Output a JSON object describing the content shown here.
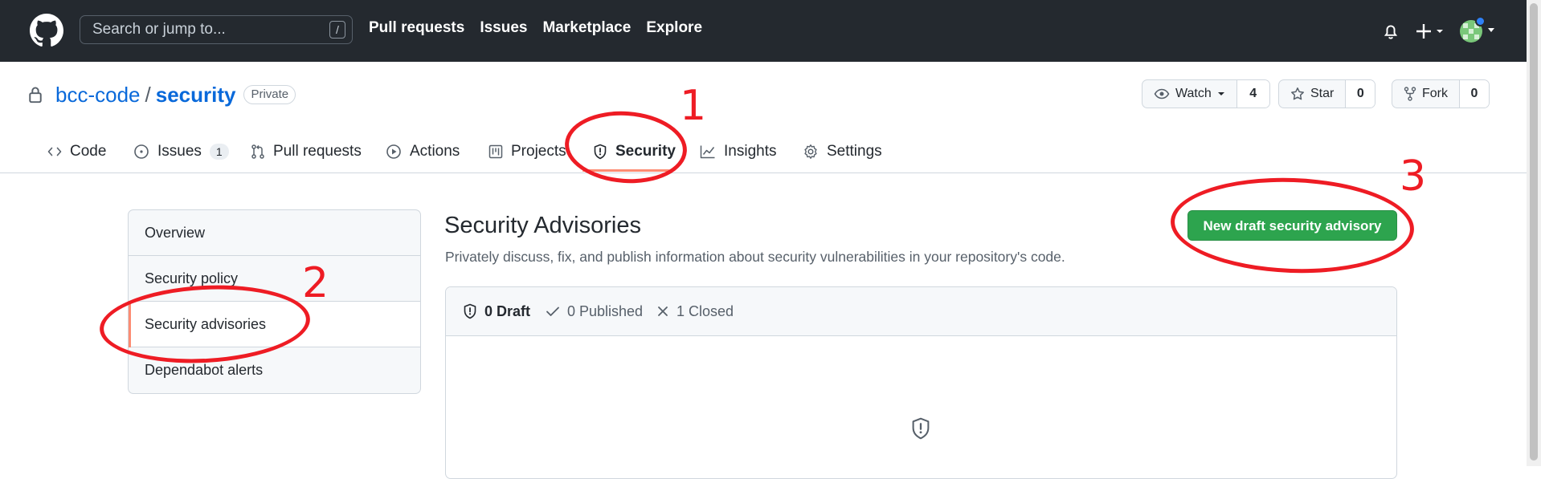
{
  "header": {
    "search_placeholder": "Search or jump to...",
    "search_shortcut": "/",
    "nav": [
      "Pull requests",
      "Issues",
      "Marketplace",
      "Explore"
    ]
  },
  "repo": {
    "owner": "bcc-code",
    "separator": "/",
    "name": "security",
    "visibility": "Private",
    "watch_label": "Watch",
    "watch_count": "4",
    "star_label": "Star",
    "star_count": "0",
    "fork_label": "Fork",
    "fork_count": "0"
  },
  "tabs": [
    {
      "label": "Code",
      "icon": "code-icon"
    },
    {
      "label": "Issues",
      "icon": "issue-opened-icon",
      "count": "1"
    },
    {
      "label": "Pull requests",
      "icon": "git-pull-request-icon"
    },
    {
      "label": "Actions",
      "icon": "play-icon"
    },
    {
      "label": "Projects",
      "icon": "project-icon"
    },
    {
      "label": "Security",
      "icon": "shield-icon",
      "selected": true
    },
    {
      "label": "Insights",
      "icon": "graph-icon"
    },
    {
      "label": "Settings",
      "icon": "gear-icon"
    }
  ],
  "sidebar": {
    "items": [
      {
        "label": "Overview"
      },
      {
        "label": "Security policy"
      },
      {
        "label": "Security advisories",
        "selected": true
      },
      {
        "label": "Dependabot alerts"
      }
    ]
  },
  "main": {
    "title": "Security Advisories",
    "description": "Privately discuss, fix, and publish information about security vulnerabilities in your repository's code.",
    "new_button": "New draft security advisory",
    "filters": [
      {
        "label": "0 Draft",
        "icon": "shield-icon",
        "active": true
      },
      {
        "label": "0 Published",
        "icon": "check-icon"
      },
      {
        "label": "1 Closed",
        "icon": "x-icon"
      }
    ]
  },
  "annotations": {
    "labels": [
      "1",
      "2",
      "3"
    ],
    "color": "#ee1c24"
  },
  "colors": {
    "header_bg": "#24292f",
    "link": "#0969da",
    "primary_button": "#2da44e",
    "tab_underline": "#fd8c73"
  }
}
